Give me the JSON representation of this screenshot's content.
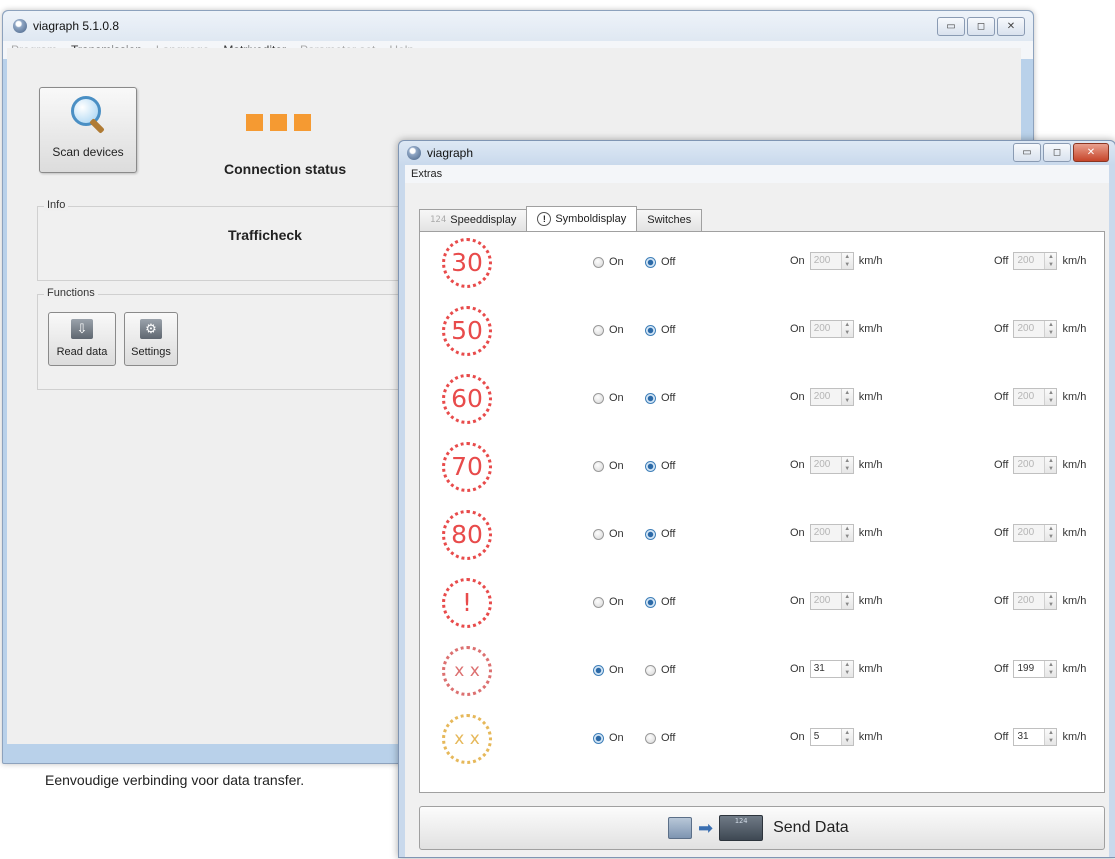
{
  "main_window": {
    "title": "viagraph 5.1.0.8",
    "menu": [
      {
        "label": "Program",
        "enabled": false
      },
      {
        "label": "Transmission",
        "enabled": true
      },
      {
        "label": "Language",
        "enabled": false
      },
      {
        "label": "Matrixeditor",
        "enabled": true
      },
      {
        "label": "Parameter set",
        "enabled": false
      },
      {
        "label": "Help",
        "enabled": false
      }
    ],
    "scan_button_label": "Scan devices",
    "connection_status_label": "Connection status",
    "status_color": "#f59a32",
    "info_group_title": "Info",
    "device_name": "Trafficheck",
    "functions_group_title": "Functions",
    "read_data_label": "Read data",
    "settings_label": "Settings",
    "window_buttons": {
      "minimize": "▭",
      "maximize": "◻",
      "close": "✕"
    }
  },
  "caption": "Eenvoudige verbinding voor data transfer.",
  "dialog": {
    "title": "viagraph",
    "menu": [
      "Extras"
    ],
    "tabs": [
      {
        "label": "Speeddisplay",
        "icon": "124",
        "active": false
      },
      {
        "label": "Symboldisplay",
        "icon": "!",
        "active": true
      },
      {
        "label": "Switches",
        "active": false
      }
    ],
    "on_label": "On",
    "off_label": "Off",
    "unit": "km/h",
    "rows": [
      {
        "symbol": "30",
        "style": "red",
        "state": "off",
        "on_value": "200",
        "off_value": "200",
        "enabled": false
      },
      {
        "symbol": "50",
        "style": "red",
        "state": "off",
        "on_value": "200",
        "off_value": "200",
        "enabled": false
      },
      {
        "symbol": "60",
        "style": "red",
        "state": "off",
        "on_value": "200",
        "off_value": "200",
        "enabled": false
      },
      {
        "symbol": "70",
        "style": "red",
        "state": "off",
        "on_value": "200",
        "off_value": "200",
        "enabled": false
      },
      {
        "symbol": "80",
        "style": "red",
        "state": "off",
        "on_value": "200",
        "off_value": "200",
        "enabled": false
      },
      {
        "symbol": "!",
        "style": "red",
        "state": "off",
        "on_value": "200",
        "off_value": "200",
        "enabled": false
      },
      {
        "symbol": "sad-face",
        "style": "gray",
        "state": "on",
        "on_value": "31",
        "off_value": "199",
        "enabled": true
      },
      {
        "symbol": "sad-face",
        "style": "gold",
        "state": "on",
        "on_value": "5",
        "off_value": "31",
        "enabled": true
      }
    ],
    "send_button_label": "Send Data",
    "display_icon_text": "124",
    "window_buttons": {
      "minimize": "▭",
      "maximize": "◻",
      "close": "✕"
    }
  }
}
